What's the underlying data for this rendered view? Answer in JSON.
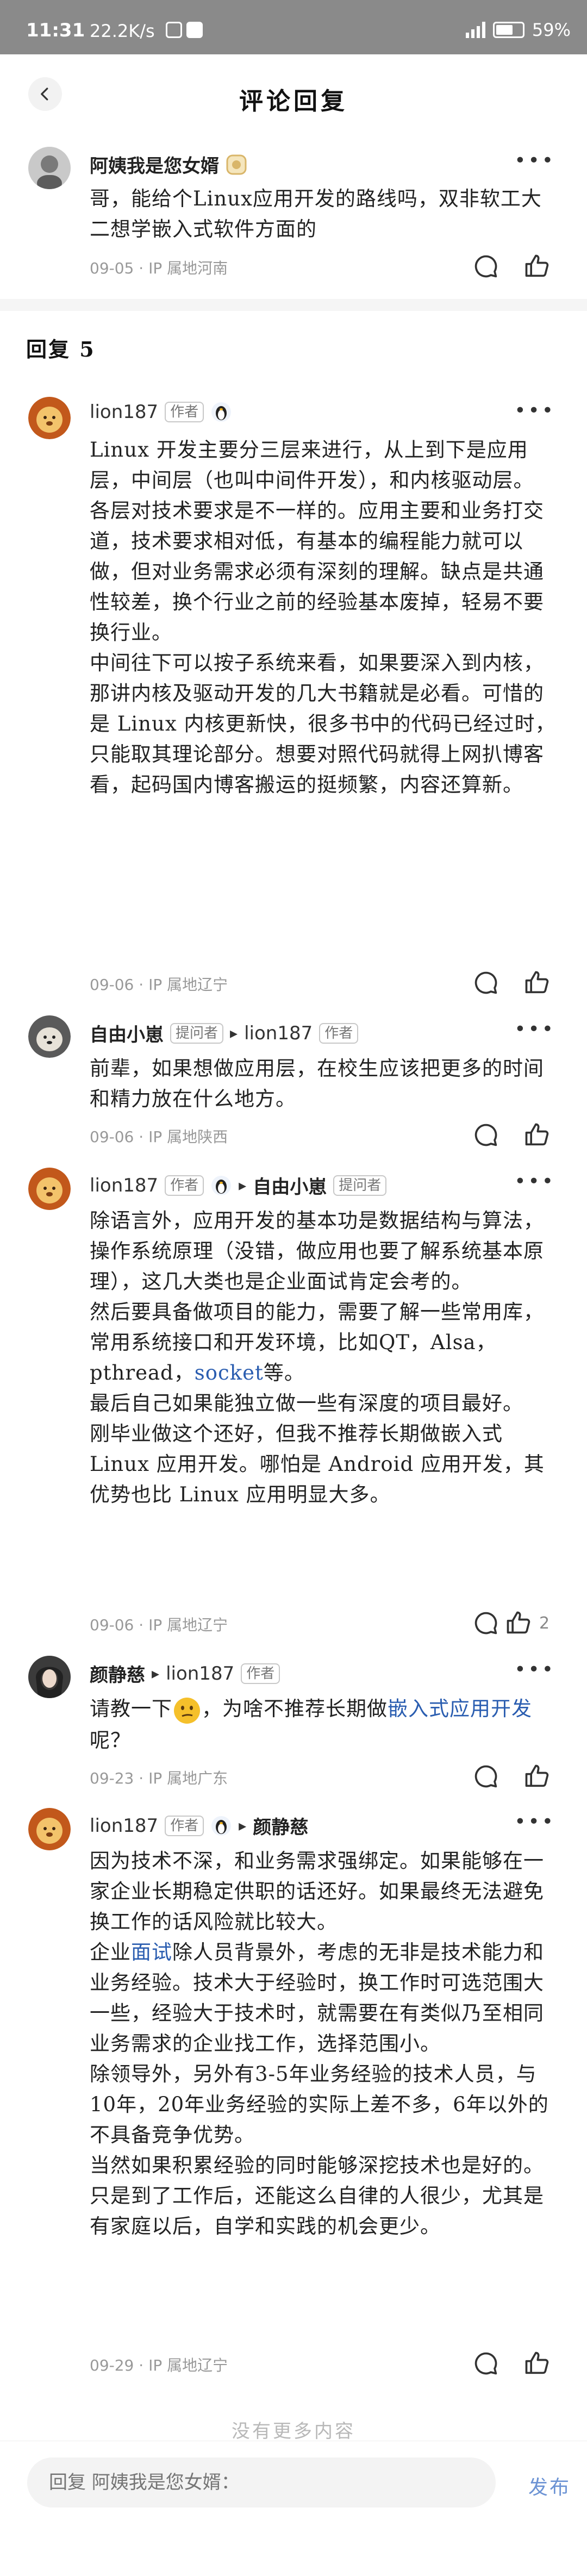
{
  "status_bar": {
    "time": "11:31",
    "speed": "22.2K/s",
    "battery": "59"
  },
  "header": {
    "title": "评论回复"
  },
  "original": {
    "author": "阿姨我是您女婿",
    "text": "哥，能给个Linux应用开发的路线吗，双非软工大二想学嵌入式软件方面的",
    "meta": "09-05 · IP 属地河南"
  },
  "replies_section": {
    "title": "回复 5"
  },
  "replies": [
    {
      "author": "lion187",
      "tag": "作者",
      "paragraphs": [
        "Linux 开发主要分三层来进行，从上到下是应用层，中间层（也叫中间件开发），和内核驱动层。",
        "各层对技术要求是不一样的。应用主要和业务打交道，技术要求相对低，有基本的编程能力就可以做，但对业务需求必须有深刻的理解。缺点是共通性较差，换个行业之前的经验基本废掉，轻易不要换行业。",
        "中间往下可以按子系统来看，如果要深入到内核，那讲内核及驱动开发的几大书籍就是必看。可惜的是 Linux 内核更新快，很多书中的代码已经过时，只能取其理论部分。想要对照代码就得上网扒博客看，起码国内博客搬运的挺频繁，内容还算新。"
      ],
      "meta": "09-06 · IP 属地辽宁"
    },
    {
      "author": "自由小崽",
      "tag": "提问者",
      "target": "lion187",
      "target_tag": "作者",
      "text": "前辈，如果想做应用层，在校生应该把更多的时间和精力放在什么地方。",
      "meta": "09-06 · IP 属地陕西"
    },
    {
      "author": "lion187",
      "tag": "作者",
      "target": "自由小崽",
      "target_tag": "提问者",
      "para1_a": "除语言外，应用开发的基本功是数据结构与算法，操作系统原理（没错，做应用也要了解系统基本原理），这几大类也是企业面试肯定会考的。",
      "para2_a": "然后要具备做项目的能力，需要了解一些常用库，常用系统接口和开发环境，比如QT，Alsa，pthread，",
      "para2_link": "socket",
      "para2_b": "等。",
      "para3": "最后自己如果能独立做一些有深度的项目最好。",
      "para4": "刚毕业做这个还好，但我不推荐长期做嵌入式 Linux 应用开发。哪怕是 Android 应用开发，其优势也比 Linux 应用明显大多。",
      "meta": "09-06 · IP 属地辽宁",
      "likes": "2"
    },
    {
      "author": "颜静慈",
      "target": "lion187",
      "target_tag": "作者",
      "text_a": "请教一下",
      "text_b": "，为啥不推荐长期做",
      "link": "嵌入式应用开发",
      "text_c": "呢？",
      "meta": "09-23 · IP 属地广东"
    },
    {
      "author": "lion187",
      "tag": "作者",
      "target": "颜静慈",
      "para1": "因为技术不深，和业务需求强绑定。如果能够在一家企业长期稳定供职的话还好。如果最终无法避免换工作的话风险就比较大。",
      "para2_a": "企业",
      "para2_link": "面试",
      "para2_b": "除人员背景外，考虑的无非是技术能力和业务经验。技术大于经验时，换工作时可选范围大一些，经验大于技术时，就需要在有类似乃至相同业务需求的企业找工作，选择范围小。",
      "para3": "除领导外，另外有3-5年业务经验的技术人员，与10年，20年业务经验的实际上差不多，6年以外的不具备竞争优势。",
      "para4": "当然如果积累经验的同时能够深挖技术也是好的。只是到了工作后，还能这么自律的人很少，尤其是有家庭以后，自学和实践的机会更少。",
      "meta": "09-29 · IP 属地辽宁"
    }
  ],
  "footer_note": "没有更多内容",
  "bottom_bar": {
    "placeholder": "回复 阿姨我是您女婿：",
    "publish": "发布"
  }
}
